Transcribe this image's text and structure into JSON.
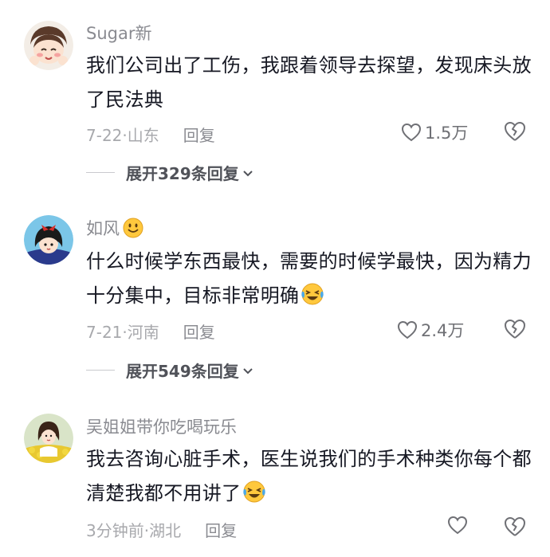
{
  "comments": [
    {
      "username": "Sugar新",
      "text": "我们公司出了工伤，我跟着领导去探望，发现床头放了民法典",
      "date_location": "7-22·山东",
      "reply_label": "回复",
      "likes": "1.5万",
      "expand_label": "展开329条回复"
    },
    {
      "username": "如风",
      "text": "什么时候学东西最快，需要的时候学最快，因为精力十分集中，目标非常明确",
      "date_location": "7-21·河南",
      "reply_label": "回复",
      "likes": "2.4万",
      "expand_label": "展开549条回复"
    },
    {
      "username": "吴姐姐带你吃喝玩乐",
      "text": "我去咨询心脏手术，医生说我们的手术种类你每个都清楚我都不用讲了",
      "date_location": "3分钟前·湖北",
      "reply_label": "回复",
      "likes": ""
    }
  ],
  "icons": {
    "like": "heart-outline-icon",
    "dislike": "broken-heart-icon",
    "expand": "chevron-down-icon",
    "emoji_smile": "smiling-face-emoji",
    "emoji_laugh": "laughing-crying-emoji"
  },
  "colors": {
    "text": "#161823",
    "muted": "#a8a9ad",
    "username": "#8a8b91"
  }
}
